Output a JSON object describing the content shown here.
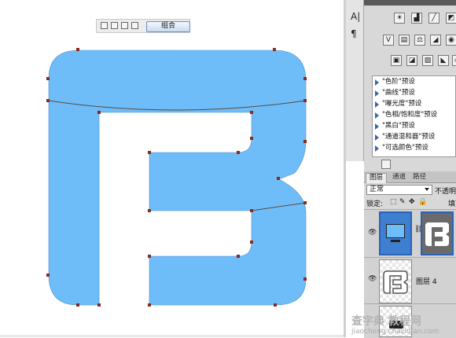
{
  "toolbar": {
    "combine_label": "组合"
  },
  "canvas": {
    "fill_color": "#6ebdf9",
    "anchor_color": "#8b2a1a"
  },
  "tool_strip": {
    "items": [
      "A|",
      "¶"
    ]
  },
  "adjustments": {
    "presets": [
      "\"色阶\"预设",
      "\"曲线\"预设",
      "\"曝光度\"预设",
      "\"色相/饱和度\"预设",
      "\"黑白\"预设",
      "\"通道混和器\"预设",
      "\"可选颜色\"预设"
    ]
  },
  "layers_panel": {
    "tabs": [
      "图层",
      "通道",
      "路径"
    ],
    "blend_mode": "正常",
    "opacity_label": "不透明度",
    "lock_label": "锁定:",
    "fill_label": "填充",
    "layers": [
      {
        "name": ""
      },
      {
        "name": "图层 4"
      },
      {
        "name": ""
      }
    ]
  },
  "watermark": {
    "line1": "查字典 教程网",
    "line2": "jiaocheng.chazidian.com"
  }
}
